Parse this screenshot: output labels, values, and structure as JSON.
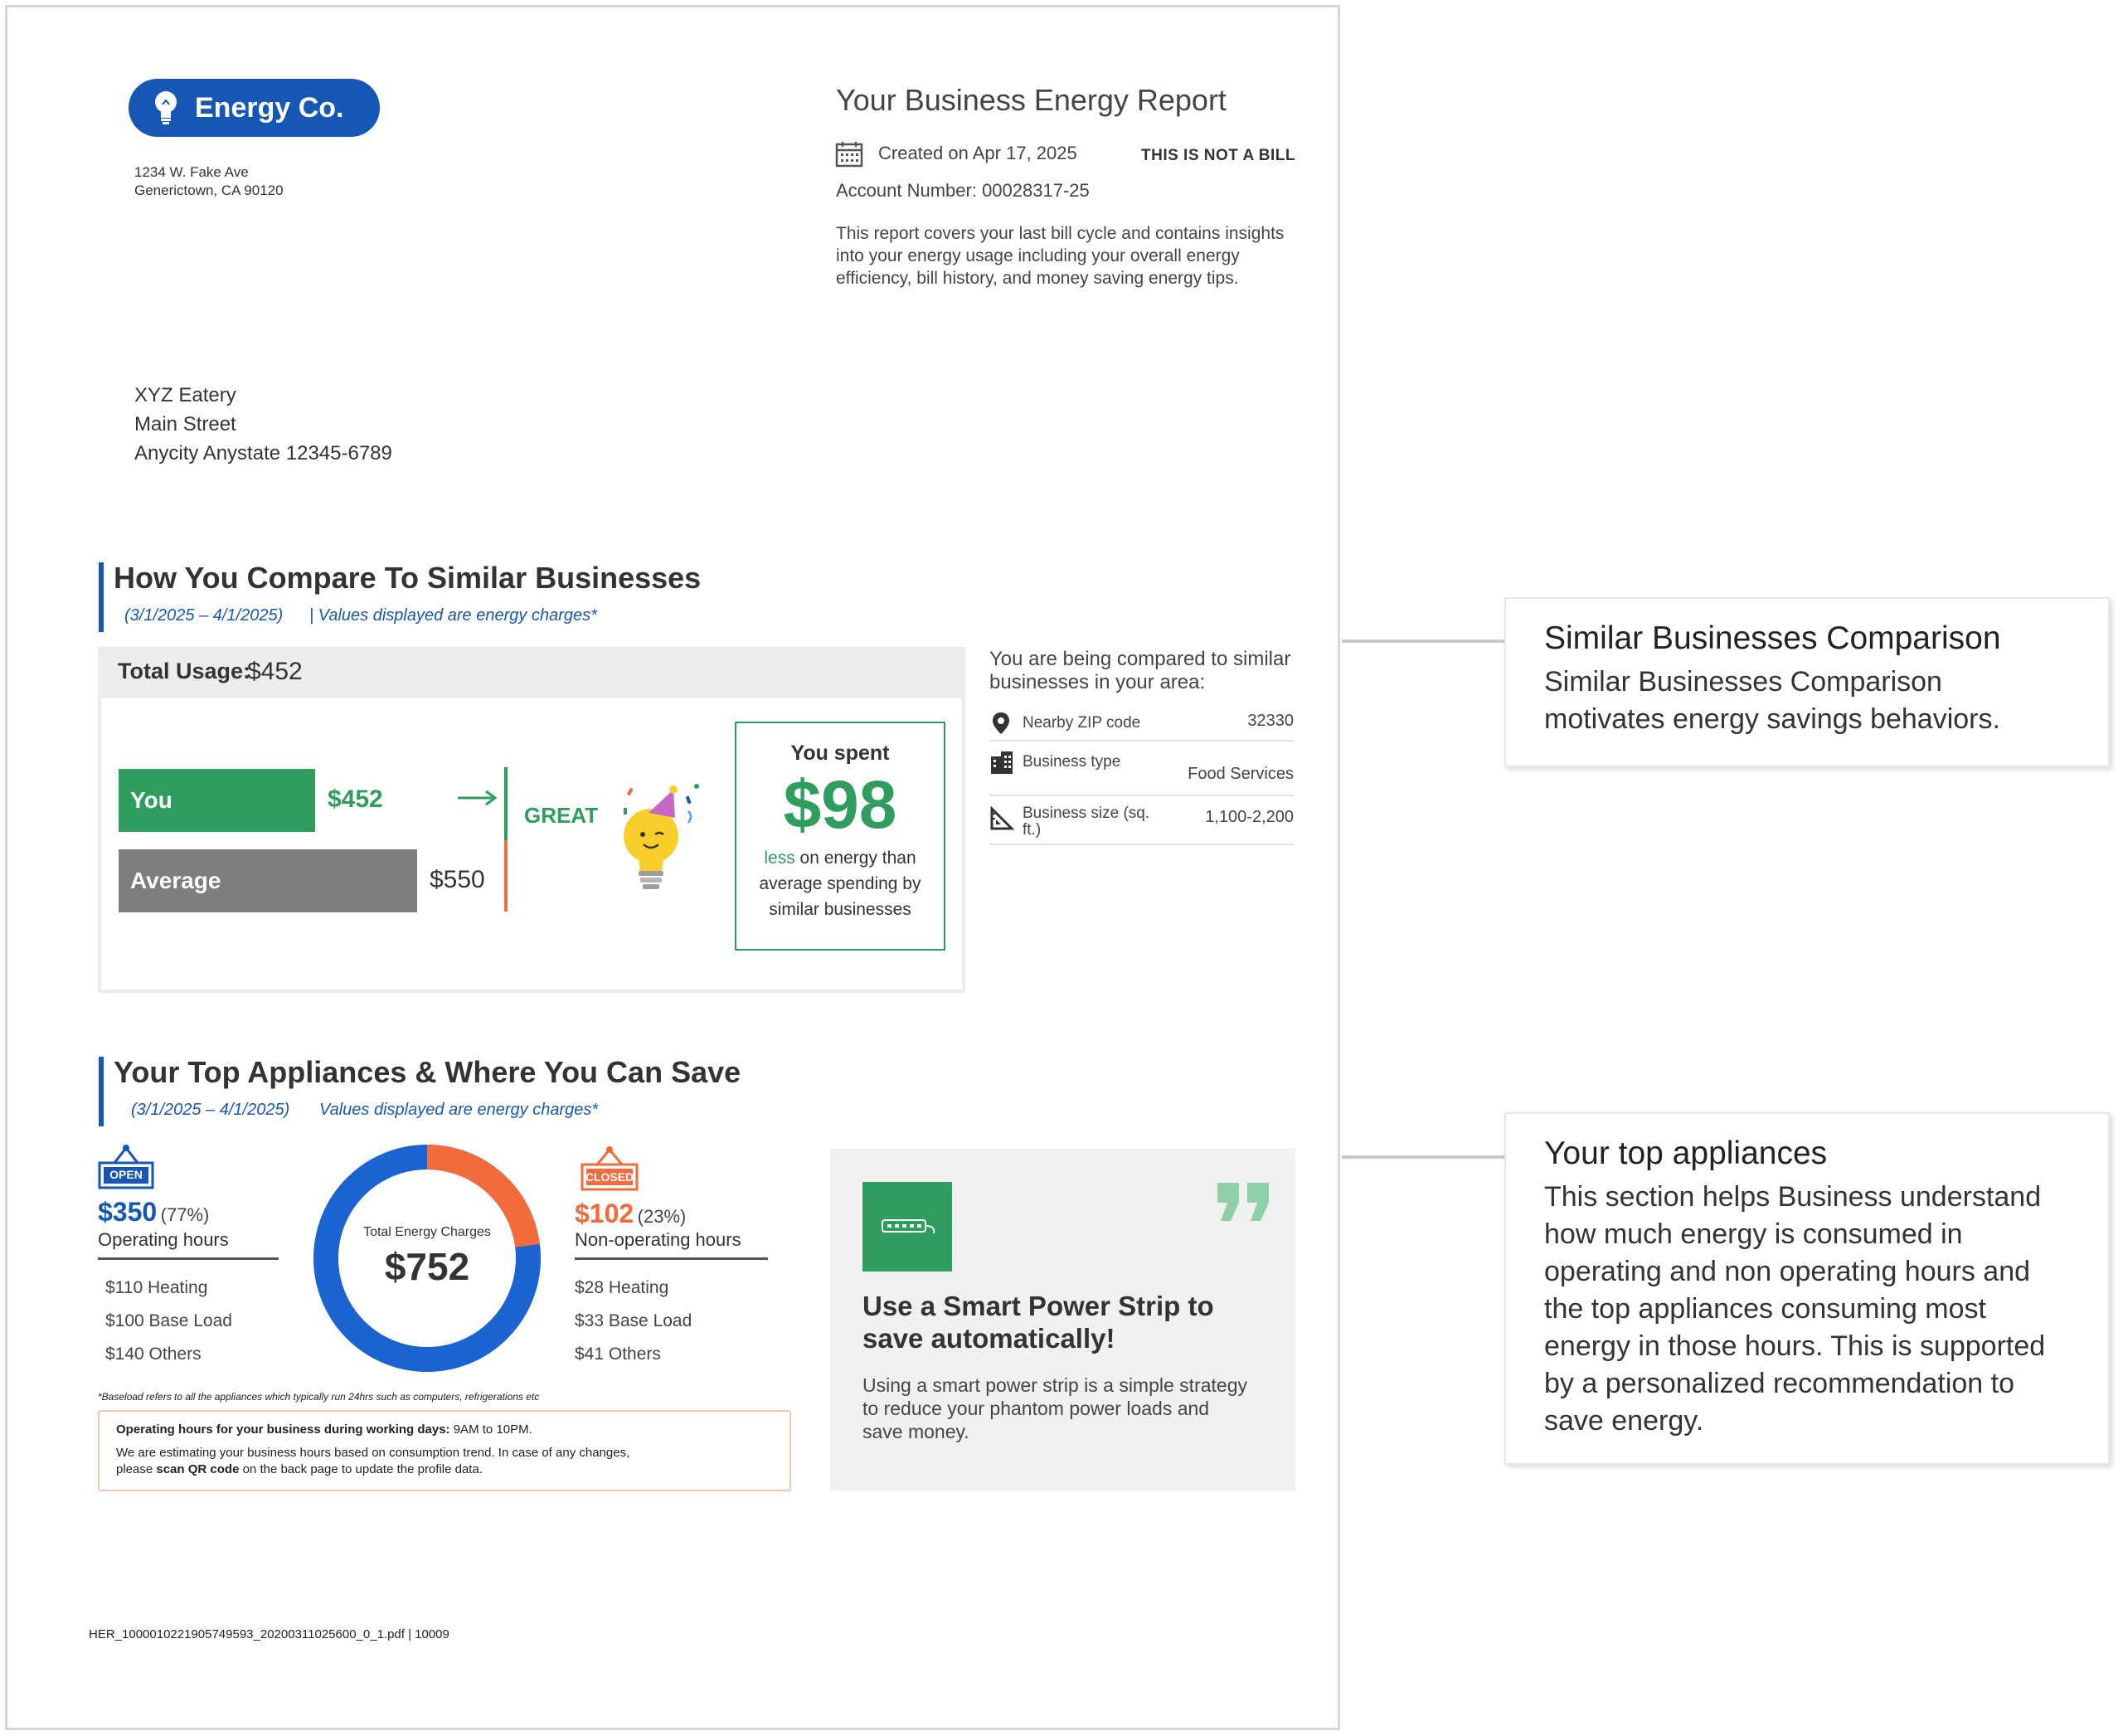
{
  "logo": {
    "text": "Energy Co.",
    "icon": "lightbulb-icon"
  },
  "company_address": {
    "line1": "1234 W. Fake Ave",
    "line2": "Generictown, CA 90120"
  },
  "report": {
    "title": "Your Business Energy Report",
    "created": "Created on Apr 17, 2025",
    "not_bill": "THIS IS NOT A BILL",
    "account": "Account Number: 00028317-25",
    "description": "This report covers your last bill cycle and contains insights into your energy usage including your overall energy efficiency, bill history, and money saving energy tips."
  },
  "recipient": {
    "name": "XYZ Eatery",
    "street": "Main Street",
    "city": "Anycity Anystate 12345-6789"
  },
  "compare": {
    "title": "How You Compare To Similar Businesses",
    "dates": "(3/1/2025 – 4/1/2025)",
    "note": "| Values displayed are energy charges*",
    "total_usage_label": "Total Usage:",
    "total_usage_value": "$452",
    "you_label": "You",
    "you_value": "$452",
    "you_amount": 452,
    "avg_label": "Average",
    "avg_value": "$550",
    "avg_amount": 550,
    "rating": "GREAT",
    "spent_label": "You spent",
    "spent_value": "$98",
    "spent_less": "less",
    "spent_rest": "on energy than average spending by similar businesses",
    "area_intro": "You are being compared to similar businesses in your area:",
    "info_rows": [
      {
        "label": "Nearby ZIP code",
        "value": "32330",
        "icon": "map-pin-icon"
      },
      {
        "label": "Business type",
        "value": "Food Services",
        "icon": "building-icon"
      },
      {
        "label": "Business size (sq. ft.)",
        "value": "1,100-2,200",
        "icon": "ruler-triangle-icon"
      }
    ]
  },
  "appliances": {
    "title": "Your Top Appliances & Where You Can Save",
    "dates": "(3/1/2025 – 4/1/2025)",
    "note": "Values displayed are energy charges*",
    "open_badge": "OPEN",
    "closed_badge": "CLOSED",
    "operating": {
      "value": "$350",
      "pct": "(77%)",
      "label": "Operating hours",
      "items": [
        "$110 Heating",
        "$100 Base Load",
        "$140 Others"
      ]
    },
    "non_operating": {
      "value": "$102",
      "pct": "(23%)",
      "label": "Non-operating hours",
      "items": [
        "$28 Heating",
        "$33 Base Load",
        "$41 Others"
      ]
    },
    "donut": {
      "label": "Total Energy Charges",
      "total": "$752",
      "operating_share": 0.77,
      "non_operating_share": 0.23
    },
    "footnote": "*Baseload refers to all the appliances which typically run 24hrs such as computers, refrigerations etc",
    "hours_bold": "Operating hours for your business during working days:",
    "hours_value": "9AM to 10PM.",
    "hours_note_1": "We are estimating your business hours based on consumption trend. In case of any changes,",
    "hours_note_2a": "please",
    "hours_note_2b": "scan QR code",
    "hours_note_2c": "on the back page to update the profile data.",
    "tip": {
      "icon": "power-strip-icon",
      "title": "Use a Smart Power Strip to save automatically!",
      "body": "Using a smart power strip is a simple strategy to reduce your phantom power loads and save money."
    }
  },
  "footer": "HER_1000010221905749593_20200311025600_0_1.pdf | 10009",
  "callouts": [
    {
      "title": "Similar Businesses Comparison",
      "body": "Similar Businesses Comparison motivates energy savings behaviors."
    },
    {
      "title": "Your top appliances",
      "body": "This section helps Business understand how much energy is consumed in operating and non operating hours and the top appliances consuming most energy in those hours. This is supported by a personalized recommendation to save energy."
    }
  ],
  "colors": {
    "brand_blue": "#1656b4",
    "green": "#2e9d5e",
    "orange": "#f26b3a",
    "gray_bar": "#7d7d7d"
  }
}
